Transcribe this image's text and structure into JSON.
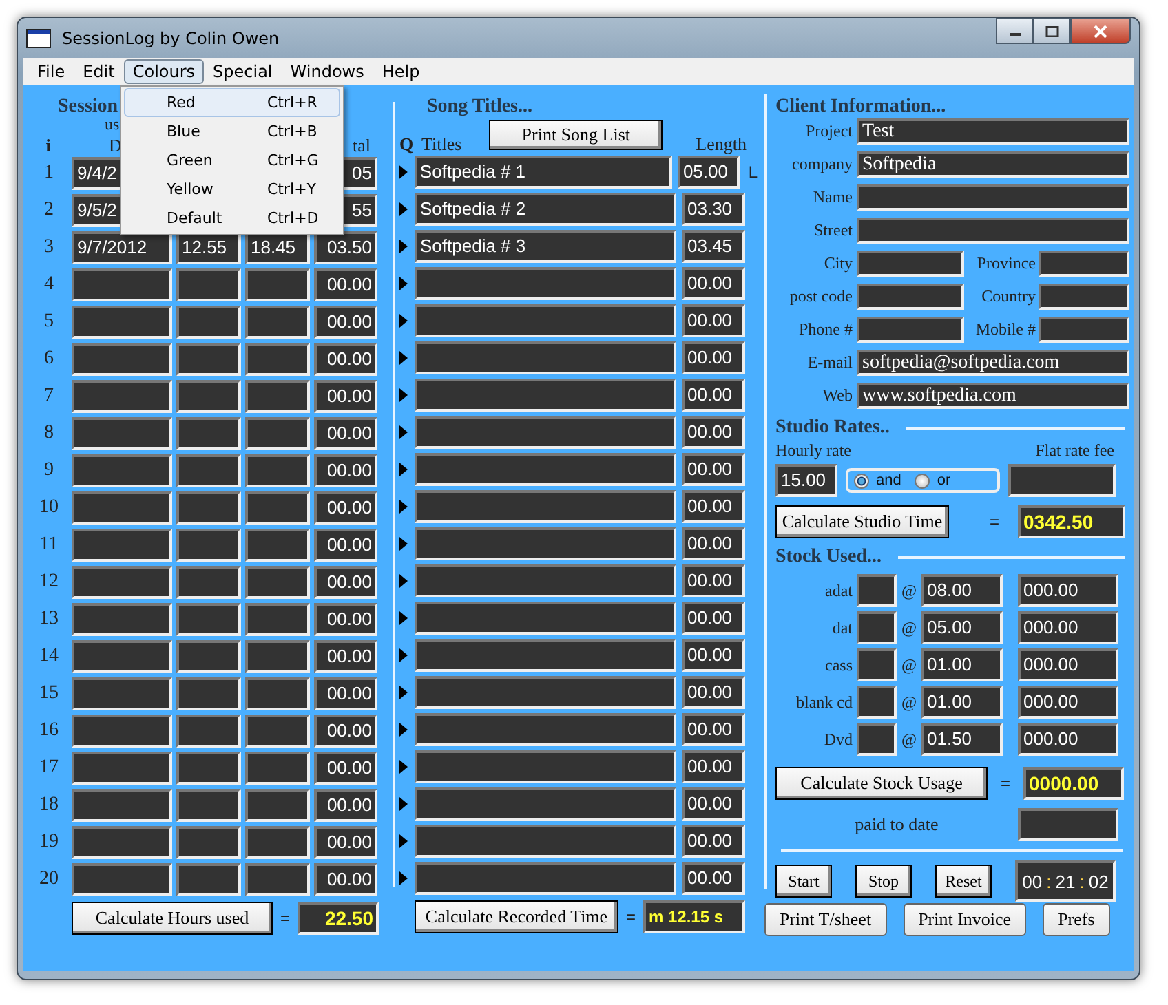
{
  "window": {
    "title": "SessionLog by Colin Owen"
  },
  "menu": [
    {
      "label": "File",
      "selected": false
    },
    {
      "label": "Edit",
      "selected": false
    },
    {
      "label": "Colours",
      "selected": true
    },
    {
      "label": "Special",
      "selected": false
    },
    {
      "label": "Windows",
      "selected": false
    },
    {
      "label": "Help",
      "selected": false
    }
  ],
  "dropdown": [
    {
      "label": "Red",
      "shortcut": "Ctrl+R",
      "selected": true
    },
    {
      "label": "Blue",
      "shortcut": "Ctrl+B",
      "selected": false
    },
    {
      "label": "Green",
      "shortcut": "Ctrl+G",
      "selected": false
    },
    {
      "label": "Yellow",
      "shortcut": "Ctrl+Y",
      "selected": false
    },
    {
      "label": "Default",
      "shortcut": "Ctrl+D",
      "selected": false
    }
  ],
  "session": {
    "title": "Session",
    "subtitle": "us",
    "headers": [
      "i",
      "D",
      "tal"
    ],
    "rows": [
      {
        "number": "1",
        "date": "9/4/2",
        "total": "05"
      },
      {
        "number": "2",
        "date": "9/5/2",
        "total": "55"
      },
      {
        "number": "3",
        "date": "9/7/2012",
        "start": "12.55",
        "end": "18.45",
        "total": "03.50"
      },
      {
        "number": "4",
        "total": "00.00"
      },
      {
        "number": "5",
        "total": "00.00"
      },
      {
        "number": "6",
        "total": "00.00"
      },
      {
        "number": "7",
        "total": "00.00"
      },
      {
        "number": "8",
        "total": "00.00"
      },
      {
        "number": "9",
        "total": "00.00"
      },
      {
        "number": "10",
        "total": "00.00"
      },
      {
        "number": "11",
        "total": "00.00"
      },
      {
        "number": "12",
        "total": "00.00"
      },
      {
        "number": "13",
        "total": "00.00"
      },
      {
        "number": "14",
        "total": "00.00"
      },
      {
        "number": "15",
        "total": "00.00"
      },
      {
        "number": "16",
        "total": "00.00"
      },
      {
        "number": "17",
        "total": "00.00"
      },
      {
        "number": "18",
        "total": "00.00"
      },
      {
        "number": "19",
        "total": "00.00"
      },
      {
        "number": "20",
        "total": "00.00"
      }
    ],
    "calc_button": "Calculate Hours used",
    "equals": "=",
    "result": "22.50"
  },
  "songs": {
    "title": "Song Titles...",
    "print_button": "Print Song List",
    "headers": [
      "Q",
      "Titles",
      "Length"
    ],
    "marker": "L",
    "rows": [
      {
        "title": "Softpedia # 1",
        "length": "05.00"
      },
      {
        "title": "Softpedia # 2",
        "length": "03.30"
      },
      {
        "title": "Softpedia # 3",
        "length": "03.45"
      },
      {
        "length": "00.00"
      },
      {
        "length": "00.00"
      },
      {
        "length": "00.00"
      },
      {
        "length": "00.00"
      },
      {
        "length": "00.00"
      },
      {
        "length": "00.00"
      },
      {
        "length": "00.00"
      },
      {
        "length": "00.00"
      },
      {
        "length": "00.00"
      },
      {
        "length": "00.00"
      },
      {
        "length": "00.00"
      },
      {
        "length": "00.00"
      },
      {
        "length": "00.00"
      },
      {
        "length": "00.00"
      },
      {
        "length": "00.00"
      },
      {
        "length": "00.00"
      },
      {
        "length": "00.00"
      }
    ],
    "calc_button": "Calculate Recorded Time",
    "equals": "=",
    "result": "m 12.15 s"
  },
  "client": {
    "title": "Client Information...",
    "rows": [
      {
        "kind": "wide",
        "label": "Project",
        "value": "Test"
      },
      {
        "kind": "wide",
        "label": "company",
        "value": "Softpedia"
      },
      {
        "kind": "wide",
        "label": "Name"
      },
      {
        "kind": "wide",
        "label": "Street"
      },
      {
        "kind": "pair",
        "label": "City",
        "label2": "Province"
      },
      {
        "kind": "pair",
        "label": "post code",
        "label2": "Country"
      },
      {
        "kind": "pair",
        "label": "Phone #",
        "label2": "Mobile #"
      },
      {
        "kind": "wide",
        "label": "E-mail",
        "value": "softpedia@softpedia.com"
      },
      {
        "kind": "wide",
        "label": "Web",
        "value": "www.softpedia.com"
      }
    ]
  },
  "studio_rates": {
    "title": "Studio Rates..",
    "hourly_label": "Hourly rate",
    "hourly": "15.00",
    "flat_label": "Flat rate fee",
    "options": [
      {
        "label": "and",
        "selected": true
      },
      {
        "label": "or",
        "selected": false
      }
    ],
    "calc_button": "Calculate Studio Time",
    "equals": "=",
    "result": "0342.50"
  },
  "stock": {
    "title": "Stock Used...",
    "items": [
      {
        "name": "adat",
        "at": "@",
        "price": "08.00",
        "total": "000.00"
      },
      {
        "name": "dat",
        "at": "@",
        "price": "05.00",
        "total": "000.00"
      },
      {
        "name": "cass",
        "at": "@",
        "price": "01.00",
        "total": "000.00"
      },
      {
        "name": "blank cd",
        "at": "@",
        "price": "01.00",
        "total": "000.00"
      },
      {
        "name": "Dvd",
        "at": "@",
        "price": "01.50",
        "total": "000.00"
      }
    ],
    "calc_button": "Calculate Stock Usage",
    "equals": "=",
    "result": "0000.00",
    "paid_label": "paid to date"
  },
  "timer": {
    "buttons": [
      "Start",
      "Stop",
      "Reset"
    ],
    "display": [
      {
        "kind": "digits",
        "text": "00"
      },
      {
        "kind": "separator",
        "text": ":"
      },
      {
        "kind": "digits",
        "text": "21"
      },
      {
        "kind": "separator",
        "text": ":"
      },
      {
        "kind": "digits",
        "text": "02"
      }
    ]
  },
  "footer_buttons": [
    "Print T/sheet",
    "Print Invoice",
    "Prefs"
  ]
}
